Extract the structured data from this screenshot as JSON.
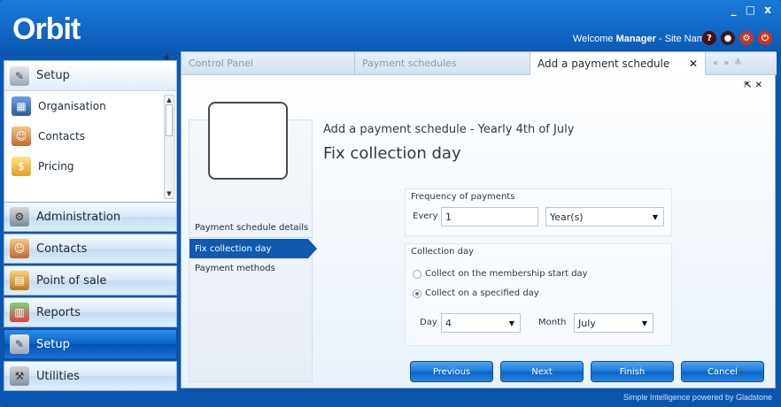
{
  "app": {
    "logo": "Orbit",
    "window_controls": "_ □ x",
    "welcome_prefix": "Welcome ",
    "user": "Manager",
    "site_text": " - Site Name",
    "footer": "Simple Intelligence powered by Gladstone"
  },
  "sidebar": {
    "top_section": {
      "header": {
        "label": "Setup",
        "icon": "setup-icon"
      },
      "items": [
        {
          "label": "Organisation",
          "icon": "organisation-icon"
        },
        {
          "label": "Contacts",
          "icon": "contacts-icon"
        },
        {
          "label": "Pricing",
          "icon": "pricing-icon"
        }
      ]
    },
    "nav": [
      {
        "label": "Administration",
        "icon": "administration-icon"
      },
      {
        "label": "Contacts",
        "icon": "contacts-icon"
      },
      {
        "label": "Point of sale",
        "icon": "point-of-sale-icon"
      },
      {
        "label": "Reports",
        "icon": "reports-icon"
      },
      {
        "label": "Setup",
        "icon": "setup-icon",
        "active": true
      },
      {
        "label": "Utilities",
        "icon": "utilities-icon"
      }
    ]
  },
  "tabs": [
    {
      "label": "Control Panel"
    },
    {
      "label": "Payment schedules"
    },
    {
      "label": "Add a payment schedule",
      "active": true
    }
  ],
  "wizard": {
    "steps": [
      {
        "label": "Payment schedule details"
      },
      {
        "label": "Fix collection day",
        "active": true
      },
      {
        "label": "Payment methods"
      }
    ],
    "subtitle": "Add a payment schedule - Yearly 4th of July",
    "title": "Fix collection day",
    "frequency": {
      "group_title": "Frequency of payments",
      "every_label": "Every",
      "every_value": "1",
      "unit_value": "Year(s)"
    },
    "collection": {
      "group_title": "Collection day",
      "option_start": "Collect on the membership start day",
      "option_specified": "Collect on a specified day",
      "selected": "specified",
      "day_label": "Day",
      "day_value": "4",
      "month_label": "Month",
      "month_value": "July"
    },
    "buttons": {
      "previous": "Previous",
      "next": "Next",
      "finish": "Finish",
      "cancel": "Cancel"
    }
  },
  "colors": {
    "window_blue": "#0b58b3",
    "active_nav": "#0453b0",
    "active_step": "#0d5ab0"
  }
}
